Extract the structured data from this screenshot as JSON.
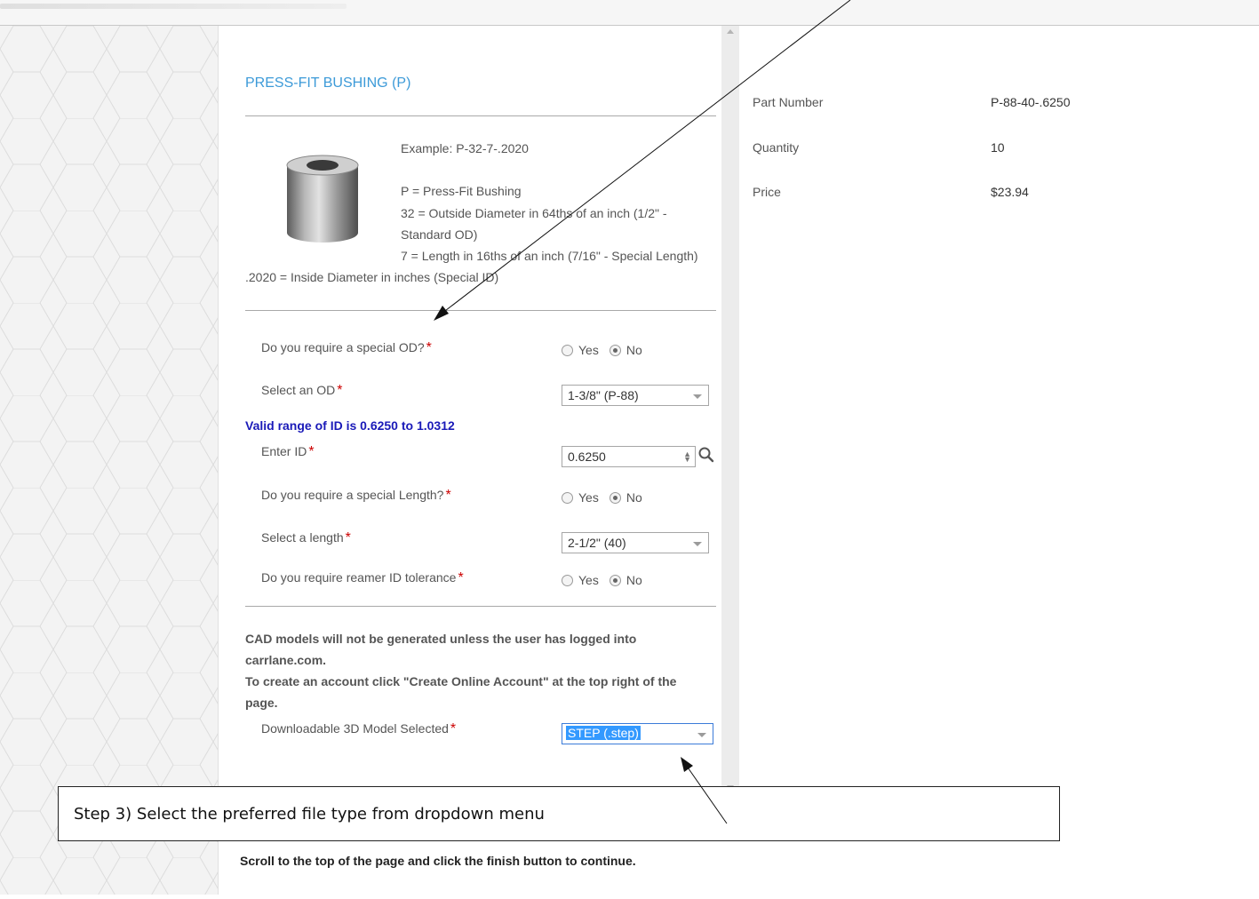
{
  "product": {
    "title": "PRESS-FIT BUSHING (P)",
    "example_lines": [
      "Example: P-32-7-.2020",
      "P = Press-Fit Bushing",
      "32 = Outside Diameter in 64ths of an inch (1/2\" -",
      "Standard OD)",
      "7 = Length in 16ths of an inch (7/16\" - Special Length)",
      ".2020 = Inside Diameter in inches (Special ID)"
    ]
  },
  "form": {
    "special_od": {
      "label": "Do you require a special OD?",
      "yes": "Yes",
      "no": "No",
      "selected": "No"
    },
    "select_od": {
      "label": "Select an OD",
      "value": "1-3/8\" (P-88)"
    },
    "id_range_note": "Valid range of ID is 0.6250 to 1.0312",
    "enter_id": {
      "label": "Enter ID",
      "value": "0.6250"
    },
    "special_length": {
      "label": "Do you require a special Length?",
      "yes": "Yes",
      "no": "No",
      "selected": "No"
    },
    "select_length": {
      "label": "Select a length",
      "value": "2-1/2\" (40)"
    },
    "reamer": {
      "label": "Do you require reamer ID tolerance",
      "yes": "Yes",
      "no": "No",
      "selected": "No"
    },
    "cad_note": [
      "CAD models will not be generated unless the user has logged into",
      "carrlane.com.",
      "To create an account click \"Create Online Account\" at the top right of the",
      "page."
    ],
    "model_select": {
      "label": "Downloadable 3D Model Selected",
      "value": "STEP (.step)"
    },
    "required_mark": "*"
  },
  "summary": {
    "part_number_label": "Part Number",
    "part_number": "P-88-40-.6250",
    "quantity_label": "Quantity",
    "quantity": "10",
    "price_label": "Price",
    "price": "$23.94"
  },
  "annotation": {
    "callout": "Step 3) Select the preferred file type from dropdown menu",
    "bottom_note": "Scroll to the top of the page and click the finish button to continue."
  },
  "icons": {
    "search": "magnifier-icon",
    "spinner": "up-down-arrows-icon"
  },
  "colors": {
    "title": "#3c9ad8",
    "required": "#cc0000",
    "info": "#1a1ab8",
    "selection": "#3399ff"
  }
}
